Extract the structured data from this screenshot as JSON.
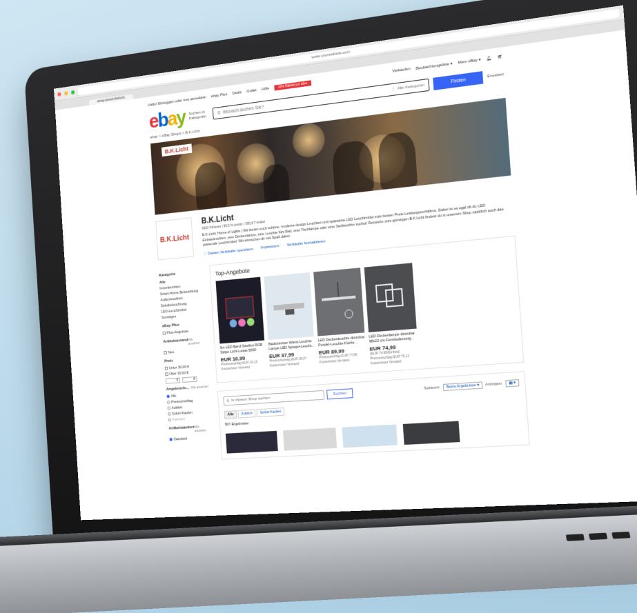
{
  "browser": {
    "url": "www.yourwebsite.com",
    "tab_title": "ebay.de/str/bklicht"
  },
  "topnav": {
    "greeting": "Hallo! Einloggen oder neu anmelden",
    "links": [
      "ebay Plus",
      "Deals",
      "Outlet",
      "Hilfe"
    ],
    "promo": "10% Rabatt auf alles",
    "right_links": [
      "Verkaufen",
      "Beobachtungsliste ▾",
      "Mein eBay ▾"
    ],
    "bell_icon": "bell-icon",
    "cart_icon": "cart-icon"
  },
  "search": {
    "category_label": "Suchen in Kategorien",
    "placeholder": "Wonach suchen Sie?",
    "category_select": "Alle Kategorien",
    "find_button": "Finden",
    "advanced": "Erweitert"
  },
  "breadcrumb": "ebay > eBay Shops > B.K.Licht",
  "banner": {
    "logo": "B.K.Licht"
  },
  "store": {
    "logo": "B.K.Licht",
    "name": "B.K.Licht",
    "meta": "9302 Follower | 99,5 % positiv | 565,8 T Artikel",
    "description": "B.K.Licht: Home of Lights | Wir bieten euch schöne, moderne design Leuchten und sparsame LED Leuchtmittel zum besten Preis-Leistungsverhältnis. Dabei ist es egal ob du LED Einbauleuchten, eine Deckenlampe, eine Leuchte fürs Bad, eine Tischlampe oder eine Stehleuchte suchst! Reinsehn zum günstigen B.K.Licht findest du in unserem Shop natürlich auch das passende Leuchtmittel. Wir wünschen dir viel Spaß dabei.",
    "links": [
      "♡ Diesen Verkäufer speichern",
      "Impressum",
      "Verkäufer kontaktieren"
    ]
  },
  "sidebar": {
    "category_title": "Kategorie",
    "categories": [
      "Alle",
      "Innenleuchten",
      "Smart-Home Beleuchtung",
      "Außenleuchten",
      "Dekobeleuchtung",
      "LED-Leuchtmittel",
      "Sonstiges"
    ],
    "plus_title": "eBay Plus",
    "plus_option": "Plus-Angebote",
    "condition_title": "Artikelzustand",
    "condition_all": "Alle ansehen",
    "condition_option": "Neu",
    "price_title": "Preis",
    "price_options": [
      "Unter 30,00 €",
      "Über 30,00 €"
    ],
    "price_from": "€",
    "price_to": "€",
    "format_title": "Angebotsfo...",
    "format_all": "Alle ansehen",
    "format_options": [
      "Alle",
      "Preisvorschlag",
      "Auktion",
      "Sofort-Kaufen",
      "Kleinanz."
    ],
    "location_title": "Artikelstandort",
    "location_all": "Alle ansehen",
    "location_option": "Standard"
  },
  "top_offers": {
    "title": "Top-Angebote",
    "products": [
      {
        "title": "5m LED Band Streifen RGB Stripe Licht-Leiste 5050 SM...",
        "price": "EUR 16,99",
        "sub1": "Preisvorschlag EUR 16,13",
        "sub2": "Kostenloser Versand",
        "color": "#1c1c28"
      },
      {
        "title": "Badezimmer Wand-Leuchte Lampe LED Spiegel-Leucht...",
        "price": "EUR 37,99",
        "sub1": "Preisvorschlag EUR 36,07",
        "sub2": "Kostenloser Versand",
        "color": "#dfe8ef"
      },
      {
        "title": "LED Deckenleuchte dimmbar Pendel-Leuchte Küche...",
        "price": "EUR 89,99",
        "sub1": "Preisvorschlag EUR 77,90",
        "sub2": "Kostenloser Versand",
        "color": "#6d6f72"
      },
      {
        "title": "LED Deckenlampe dimmbar 98x22 cm Fernbedienung...",
        "price": "EUR 74,99",
        "sub1": "(EUR 74,99/Einheit)",
        "sub2": "Preisvorschlag EUR 75,12",
        "sub3": "Kostenloser Versand",
        "color": "#4b4d51"
      }
    ]
  },
  "store_search": {
    "placeholder": "In diesem Shop suchen",
    "button": "Suchen",
    "sort_label": "Sortieren:",
    "sort_value": "Beste Ergebnisse ▾",
    "view_label": "Anzeigen:",
    "view_value": "▦ ▾",
    "chips": [
      "Alle",
      "Auktion",
      "Sofort-Kaufen"
    ],
    "results": "807 Ergebnisse"
  },
  "colors": {
    "accent": "#3665f3",
    "link": "#0654ba",
    "brand_red": "#e53238"
  }
}
